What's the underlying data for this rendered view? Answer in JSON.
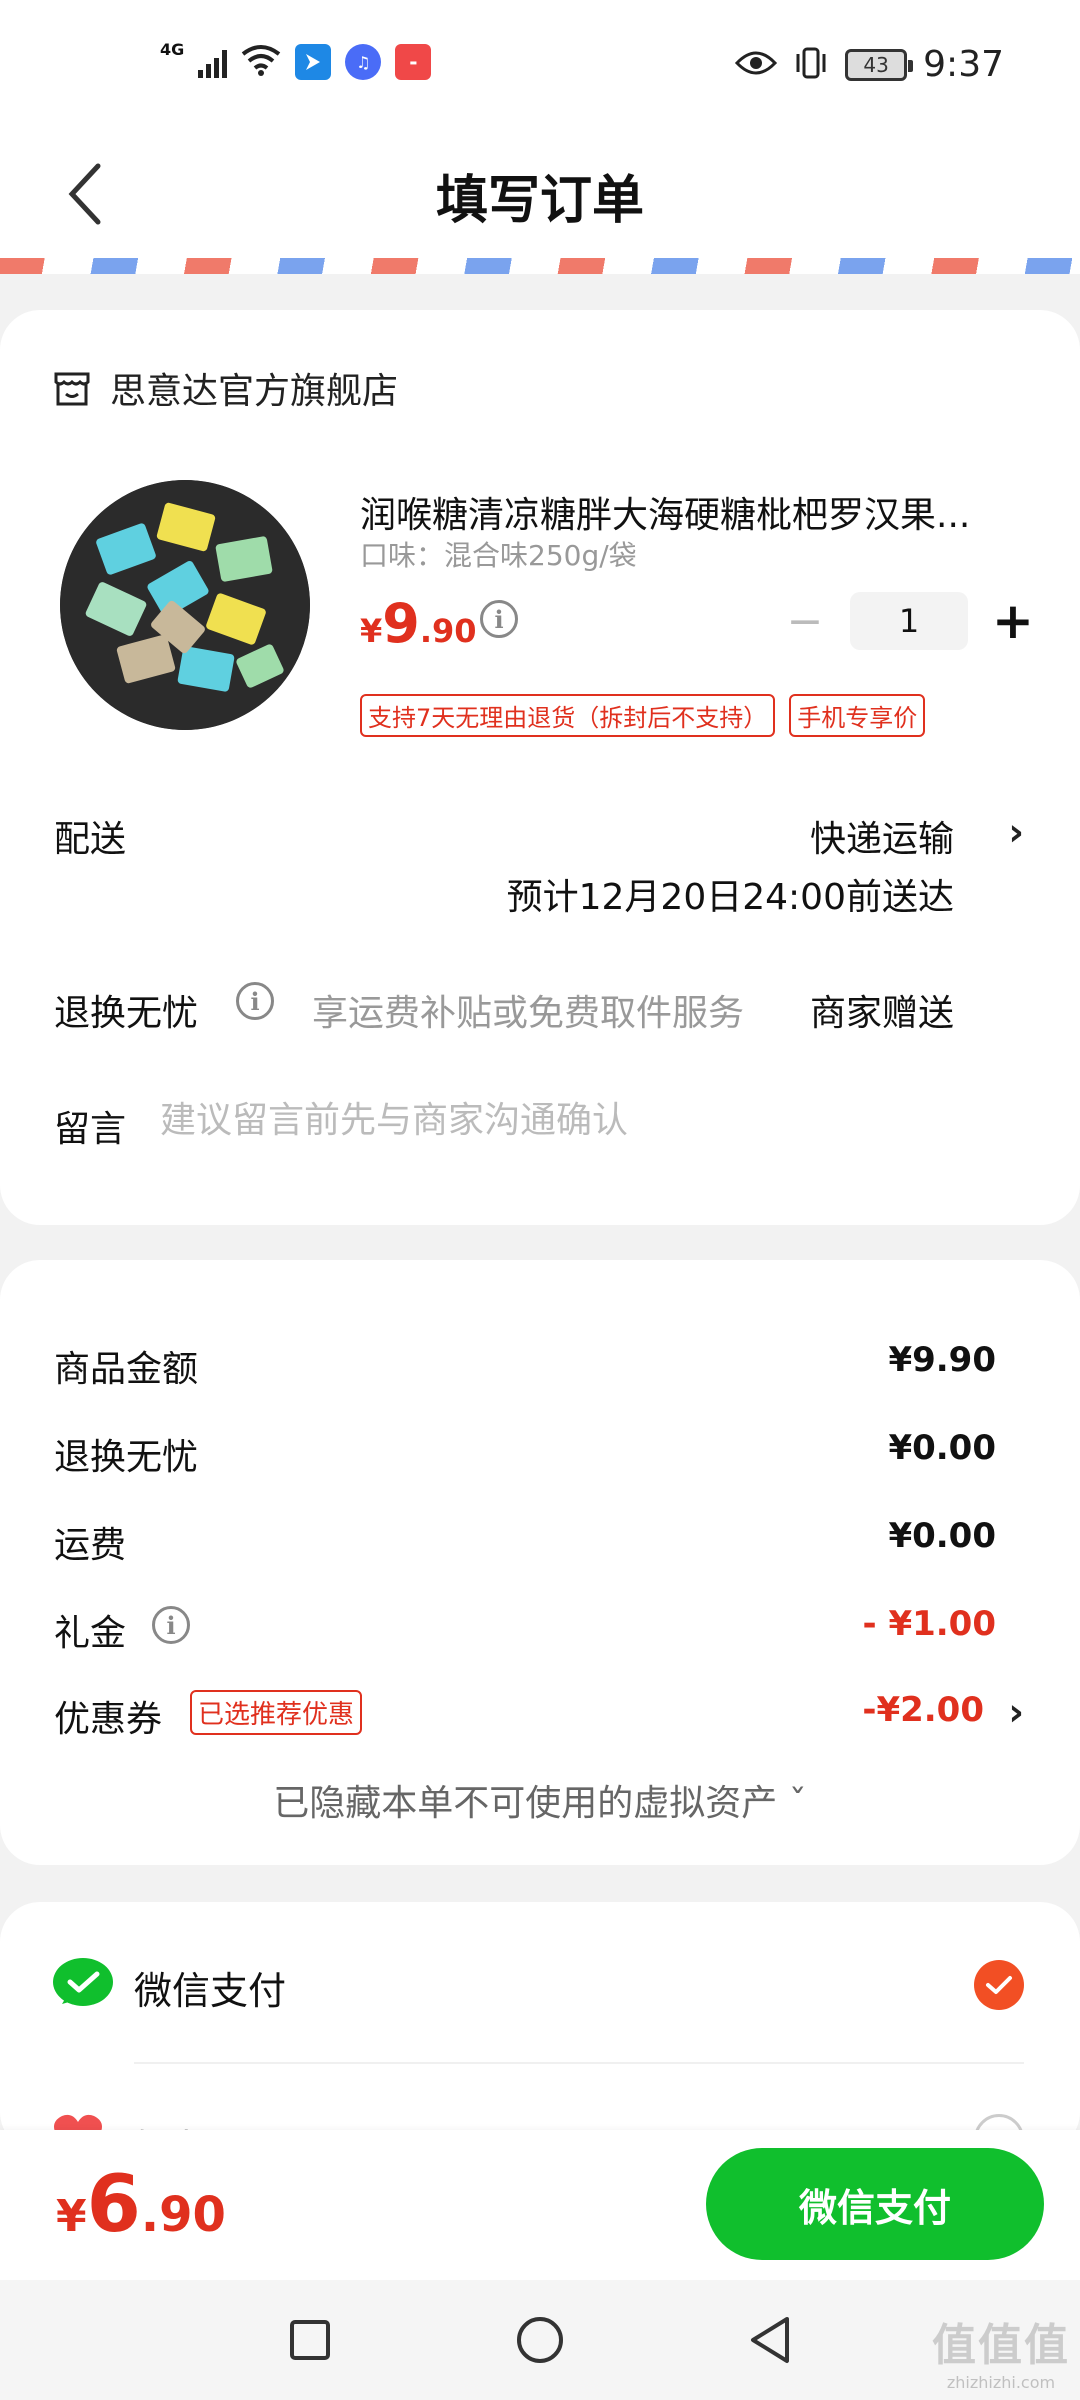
{
  "status_bar": {
    "network": "4G",
    "time": "9:37",
    "battery": "43"
  },
  "header": {
    "title": "填写订单"
  },
  "shop": {
    "name": "思意达官方旗舰店"
  },
  "product": {
    "title": "润喉糖清凉糖胖大海硬糖枇杷罗汉果...",
    "spec": "口味：混合味250g/袋",
    "price_currency": "¥",
    "price_int": "9",
    "price_dec": ".90",
    "quantity": "1",
    "tags": [
      "支持7天无理由退货（拆封后不支持）",
      "手机专享价"
    ]
  },
  "delivery": {
    "label": "配送",
    "method": "快递运输",
    "eta": "预计12月20日24:00前送达"
  },
  "returns": {
    "label": "退换无忧",
    "desc": "享运费补贴或免费取件服务",
    "value": "商家赠送"
  },
  "message": {
    "label": "留言",
    "placeholder": "建议留言前先与商家沟通确认"
  },
  "summary": {
    "goods_label": "商品金额",
    "goods_value": "¥9.90",
    "returns_label": "退换无忧",
    "returns_value": "¥0.00",
    "shipping_label": "运费",
    "shipping_value": "¥0.00",
    "gift_label": "礼金",
    "gift_value": "- ¥1.00",
    "coupon_label": "优惠券",
    "coupon_tag": "已选推荐优惠",
    "coupon_value": "-¥2.00",
    "hidden_assets": "已隐藏本单不可使用的虚拟资产 ˇ"
  },
  "payment": {
    "wechat_label": "微信支付",
    "friend_label": "好友代付"
  },
  "bottom": {
    "total_currency": "¥",
    "total_int": "6",
    "total_dec": ".90",
    "pay_button": "微信支付"
  },
  "watermark": {
    "logo": "值值值",
    "url": "zhizhizhi.com"
  },
  "colors": {
    "accent_red": "#e0301e",
    "pay_green": "#10bf2d",
    "check_orange": "#f24f24"
  },
  "icons": {
    "back": "chevron-left-icon",
    "shop": "store-icon",
    "info": "info-icon",
    "wechat": "wechat-pay-icon",
    "friend": "heart-icon"
  }
}
